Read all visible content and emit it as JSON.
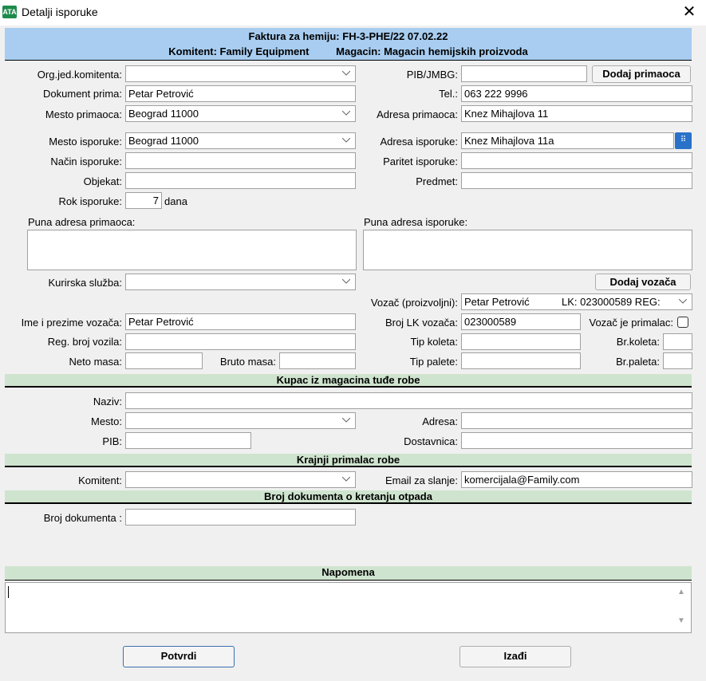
{
  "window": {
    "title": "Detalji isporuke",
    "icon_text": "ATA"
  },
  "header": {
    "line1": "Faktura za hemiju: FH-3-PHE/22  07.02.22",
    "komitent": "Komitent: Family Equipment",
    "magacin": "Magacin: Magacin hemijskih proizvoda"
  },
  "labels": {
    "org_jed": "Org.jed.komitenta:",
    "pib_jmbg": "PIB/JMBG:",
    "dokument_prima": "Dokument prima:",
    "tel": "Tel.:",
    "mesto_primaoca": "Mesto primaoca:",
    "adresa_primaoca": "Adresa primaoca:",
    "mesto_isporuke": "Mesto isporuke:",
    "adresa_isporuke": "Adresa isporuke:",
    "nacin_isporuke": "Način isporuke:",
    "paritet_isporuke": "Paritet isporuke:",
    "objekat": "Objekat:",
    "predmet": "Predmet:",
    "rok_isporuke": "Rok isporuke:",
    "dana": "dana",
    "puna_adresa_primaoca": "Puna adresa primaoca:",
    "puna_adresa_isporuke": "Puna adresa isporuke:",
    "kurirska_sluzba": "Kurirska služba:",
    "vozac_proizvoljni": "Vozač (proizvoljni):",
    "ime_prezime_vozaca": "Ime i prezime vozača:",
    "broj_lk_vozaca": "Broj LK vozača:",
    "vozac_je_primalac": "Vozač je primalac:",
    "reg_broj_vozila": "Reg. broj vozila:",
    "tip_koleta": "Tip koleta:",
    "br_koleta": "Br.koleta:",
    "neto_masa": "Neto masa:",
    "bruto_masa": "Bruto masa:",
    "tip_palete": "Tip palete:",
    "br_paleta": "Br.paleta:",
    "naziv": "Naziv:",
    "mesto": "Mesto:",
    "adresa": "Adresa:",
    "pib": "PIB:",
    "dostavnica": "Dostavnica:",
    "komitent": "Komitent:",
    "email_za_slanje": "Email za slanje:",
    "broj_dokumenta": "Broj dokumenta :"
  },
  "values": {
    "org_jed": "",
    "pib_jmbg": "",
    "dokument_prima": "Petar Petrović",
    "tel": "063 222 9996",
    "mesto_primaoca": "Beograd  11000",
    "adresa_primaoca": "Knez Mihajlova 11",
    "mesto_isporuke": "Beograd  11000",
    "adresa_isporuke": "Knez Mihajlova 11a",
    "nacin_isporuke": "",
    "paritet_isporuke": "",
    "objekat": "",
    "predmet": "",
    "rok_isporuke": "7",
    "kurirska_sluzba": "",
    "vozac_proizvoljni_name": "Petar Petrović",
    "vozac_proizvoljni_lk": "LK: 023000589 REG:",
    "ime_prezime_vozaca": "Petar Petrović",
    "broj_lk_vozaca": "023000589",
    "email_za_slanje": "komercijala@Family.com"
  },
  "buttons": {
    "dodaj_primaoca": "Dodaj primaoca",
    "dodaj_vozaca": "Dodaj vozača",
    "potvrdi": "Potvrdi",
    "izadji": "Izađi"
  },
  "sections": {
    "kupac": "Kupac iz magacina tuđe robe",
    "krajnji": "Krajnji primalac robe",
    "broj_dok_otpada": "Broj dokumenta o kretanju otpada",
    "napomena": "Napomena"
  },
  "colors": {
    "header_bg": "#a8cdf0",
    "section_bg": "#cfe4cf",
    "picker_blue": "#2a72c9"
  }
}
